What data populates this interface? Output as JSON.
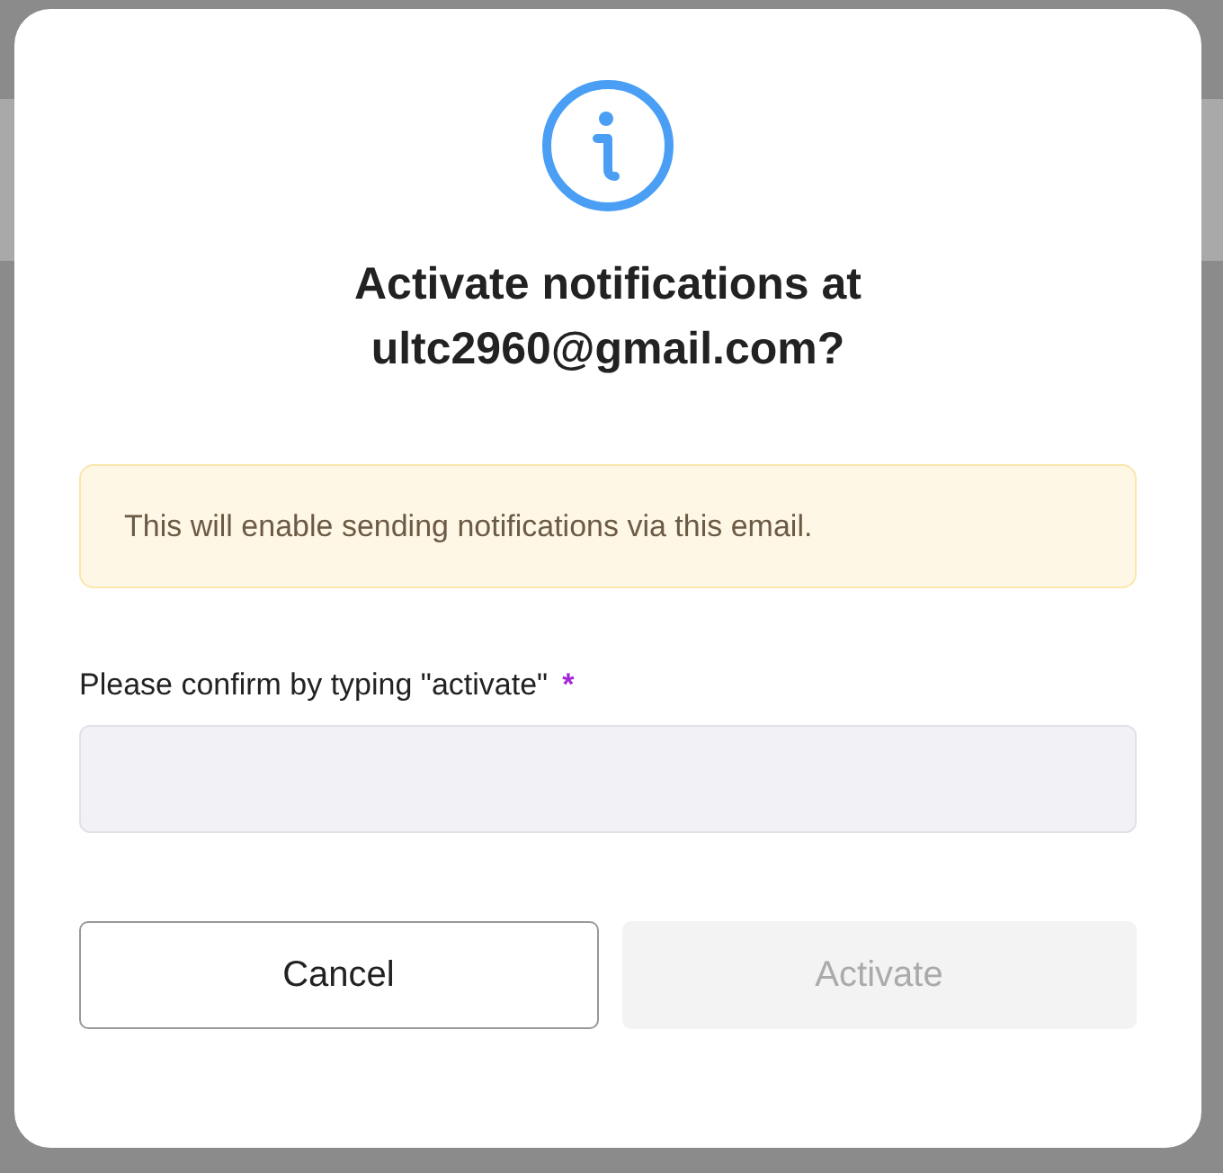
{
  "dialog": {
    "title": "Activate notifications at ultc2960@gmail.com?",
    "notice": "This will enable sending notifications via this email.",
    "field": {
      "label": "Please confirm by typing \"activate\"",
      "required": true,
      "required_mark": "*"
    },
    "buttons": [
      {
        "label": "Cancel",
        "kind": "secondary",
        "disabled": false
      },
      {
        "label": "Activate",
        "kind": "primary",
        "disabled": true
      }
    ]
  }
}
